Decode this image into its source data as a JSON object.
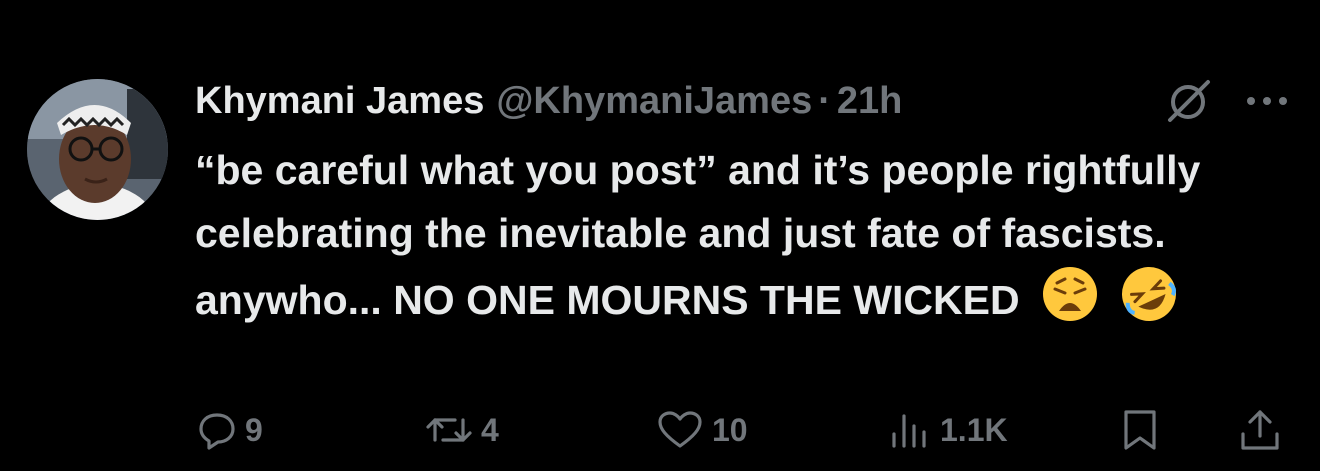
{
  "author": {
    "name": "Khymani James",
    "handle": "@KhymaniJames",
    "separator": "·",
    "time": "21h"
  },
  "tweet": {
    "text": "“be careful what you post” and it’s people rightfully celebrating the inevitable and just fate of fascists. anywho... NO ONE MOURNS THE WICKED",
    "emojis": [
      "weary-face",
      "rolling-on-the-floor-laughing"
    ]
  },
  "actions": {
    "replies": "9",
    "reposts": "4",
    "likes": "10",
    "views": "1.1K"
  },
  "colors": {
    "background": "#000000",
    "primary_text": "#e7e9ea",
    "secondary_text": "#71767b",
    "emoji_yellow": "#ffc83d"
  }
}
